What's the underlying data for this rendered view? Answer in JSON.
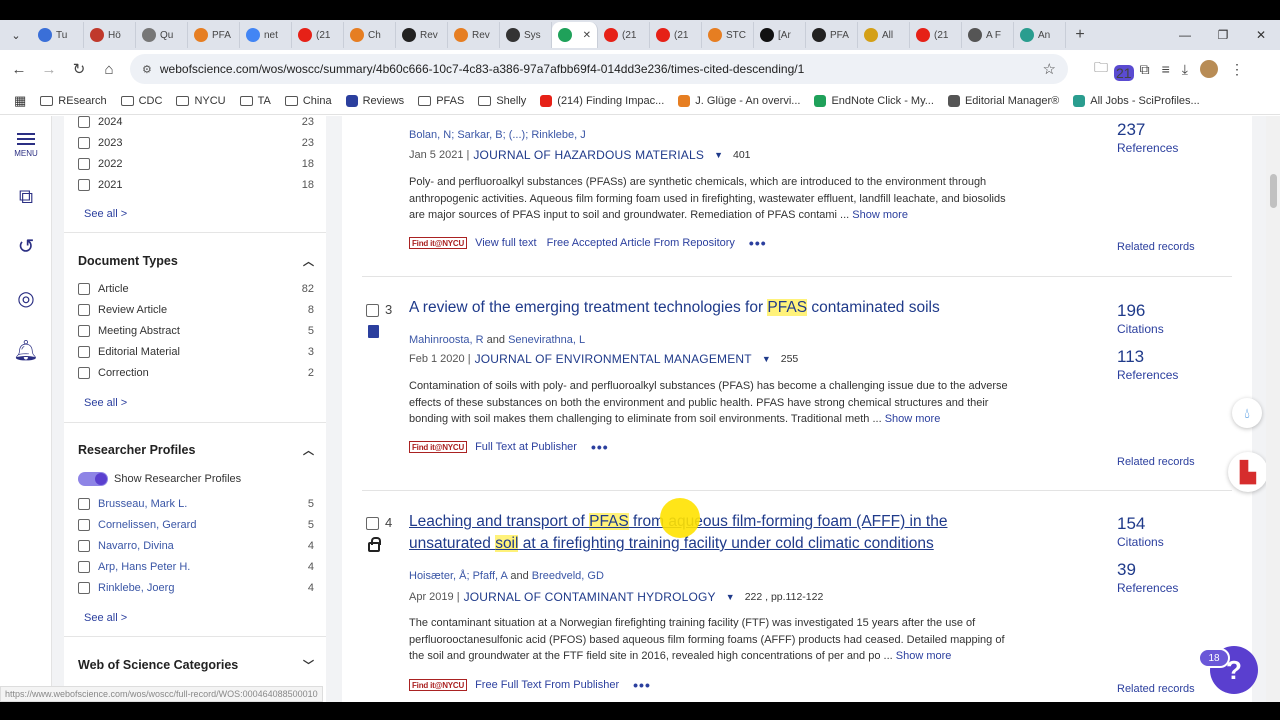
{
  "browser": {
    "tabs": [
      {
        "label": "Tu",
        "color": "#3a6fd8"
      },
      {
        "label": "Hö",
        "color": "#c0392b"
      },
      {
        "label": "Qu",
        "color": "#777777"
      },
      {
        "label": "PFA",
        "color": "#e67e22"
      },
      {
        "label": "net",
        "color": "#4285f4"
      },
      {
        "label": "(21",
        "color": "#e62117"
      },
      {
        "label": "Ch",
        "color": "#e67e22"
      },
      {
        "label": "Rev",
        "color": "#222222"
      },
      {
        "label": "Rev",
        "color": "#e67e22"
      },
      {
        "label": "Sys",
        "color": "#333333"
      },
      {
        "label": "",
        "color": "#1fa15a",
        "active": true
      },
      {
        "label": "(21",
        "color": "#e62117"
      },
      {
        "label": "(21",
        "color": "#e62117"
      },
      {
        "label": "STC",
        "color": "#e67e22"
      },
      {
        "label": "[Ar",
        "color": "#111111"
      },
      {
        "label": "PFA",
        "color": "#222222"
      },
      {
        "label": "All",
        "color": "#d4a017"
      },
      {
        "label": "(21",
        "color": "#e62117"
      },
      {
        "label": "A F",
        "color": "#555555"
      },
      {
        "label": "An",
        "color": "#2a9d8f"
      }
    ],
    "new_tab": "+",
    "url": "webofscience.com/wos/woscc/summary/4b60c666-10c7-4c83-a386-97a7afbb69f4-014dd3e236/times-cited-descending/1",
    "extension_badge": "21",
    "bookmarks": [
      {
        "label": "REsearch",
        "kind": "folder"
      },
      {
        "label": "CDC",
        "kind": "folder"
      },
      {
        "label": "NYCU",
        "kind": "folder"
      },
      {
        "label": "TA",
        "kind": "folder"
      },
      {
        "label": "China",
        "kind": "folder"
      },
      {
        "label": "Reviews",
        "kind": "icon",
        "color": "#2b3f9e"
      },
      {
        "label": "PFAS",
        "kind": "folder"
      },
      {
        "label": "Shelly",
        "kind": "folder"
      },
      {
        "label": "(214) Finding Impac...",
        "kind": "icon",
        "color": "#e62117"
      },
      {
        "label": "J. Glüge - An overvi...",
        "kind": "icon",
        "color": "#e67e22"
      },
      {
        "label": "EndNote Click - My...",
        "kind": "icon",
        "color": "#1fa15a"
      },
      {
        "label": "Editorial Manager®",
        "kind": "icon",
        "color": "#555555"
      },
      {
        "label": "All Jobs - SciProfiles...",
        "kind": "icon",
        "color": "#2a9d8f"
      }
    ]
  },
  "rail": {
    "menu_label": "MENU"
  },
  "sidebar": {
    "years": [
      {
        "label": "2024",
        "count": "23"
      },
      {
        "label": "2023",
        "count": "23"
      },
      {
        "label": "2022",
        "count": "18"
      },
      {
        "label": "2021",
        "count": "18"
      }
    ],
    "see_all_1": "See all >",
    "doc_types_heading": "Document Types",
    "doc_types": [
      {
        "label": "Article",
        "count": "82"
      },
      {
        "label": "Review Article",
        "count": "8"
      },
      {
        "label": "Meeting Abstract",
        "count": "5"
      },
      {
        "label": "Editorial Material",
        "count": "3"
      },
      {
        "label": "Correction",
        "count": "2"
      }
    ],
    "see_all_2": "See all >",
    "researcher_heading": "Researcher Profiles",
    "show_profiles_label": "Show Researcher Profiles",
    "researchers": [
      {
        "label": "Brusseau, Mark L.",
        "count": "5"
      },
      {
        "label": "Cornelissen, Gerard",
        "count": "5"
      },
      {
        "label": "Navarro, Divina",
        "count": "4"
      },
      {
        "label": "Arp, Hans Peter H.",
        "count": "4"
      },
      {
        "label": "Rinklebe, Joerg",
        "count": "4"
      }
    ],
    "see_all_3": "See all >",
    "wos_categories_heading": "Web of Science Categories"
  },
  "records": [
    {
      "authors": [
        "Bolan, N",
        "Sarkar, B",
        "(...)",
        "Rinklebe, J"
      ],
      "date": "Jan 5 2021 |",
      "journal": "JOURNAL OF HAZARDOUS MATERIALS",
      "volume": "401",
      "abstract": "Poly- and perfluoroalkyl substances (PFASs) are synthetic chemicals, which are introduced to the environment through anthropogenic activities. Aqueous film forming foam used in firefighting, wastewater effluent, landfill leachate, and biosolids are major sources of PFAS input to soil and groundwater. Remediation of PFAS contami ...",
      "show_more": "Show more",
      "actions": [
        "View full text",
        "Free Accepted Article From Repository"
      ],
      "metric_value": "237",
      "metric_label": "References",
      "related": "Related records"
    },
    {
      "number": "3",
      "title_pre": "A review of the emerging treatment technologies for ",
      "title_hl": "PFAS",
      "title_post": " contaminated soils",
      "authors": [
        "Mahinroosta, R",
        "Senevirathna, L"
      ],
      "date": "Feb 1 2020 |",
      "journal": "JOURNAL OF ENVIRONMENTAL MANAGEMENT",
      "volume": "255",
      "abstract": "Contamination of soils with poly- and perfluoroalkyl substances (PFAS) has become a challenging issue due to the adverse effects of these substances on both the environment and public health. PFAS have strong chemical structures and their bonding with soil makes them challenging to eliminate from soil environments. Traditional meth ...",
      "show_more": "Show more",
      "actions": [
        "Full Text at Publisher"
      ],
      "citations": "196",
      "citations_label": "Citations",
      "references": "113",
      "references_label": "References",
      "related": "Related records"
    },
    {
      "number": "4",
      "title_a": "Leaching and transport of ",
      "title_hl1": "PFAS",
      "title_b": " from aqueous film-forming foam (AFFF) in the unsaturated ",
      "title_hl2": "soil",
      "title_c": " at a firefighting training facility under cold climatic conditions",
      "authors": [
        "Hoisæter, Å",
        "Pfaff, A",
        "Breedveld, GD"
      ],
      "date": "Apr 2019 |",
      "journal": "JOURNAL OF CONTAMINANT HYDROLOGY",
      "volume": "222 , pp.112-122",
      "abstract": "The contaminant situation at a Norwegian firefighting training facility (FTF) was investigated 15 years after the use of perfluorooctanesulfonic acid (PFOS) based aqueous film forming foams (AFFF) products had ceased. Detailed mapping of the soil and groundwater at the FTF field site in 2016, revealed high concentrations of per and po ...",
      "show_more": "Show more",
      "actions": [
        "Free Full Text From Publisher"
      ],
      "citations": "154",
      "citations_label": "Citations",
      "references": "39",
      "references_label": "References",
      "related": "Related records"
    }
  ],
  "find_it_label": "Find it@NYCU",
  "more_dots": "•••",
  "and_word": "and",
  "help_badge": "18",
  "help_label": "?",
  "status_url": "https://www.webofscience.com/wos/woscc/full-record/WOS:000464088500010"
}
